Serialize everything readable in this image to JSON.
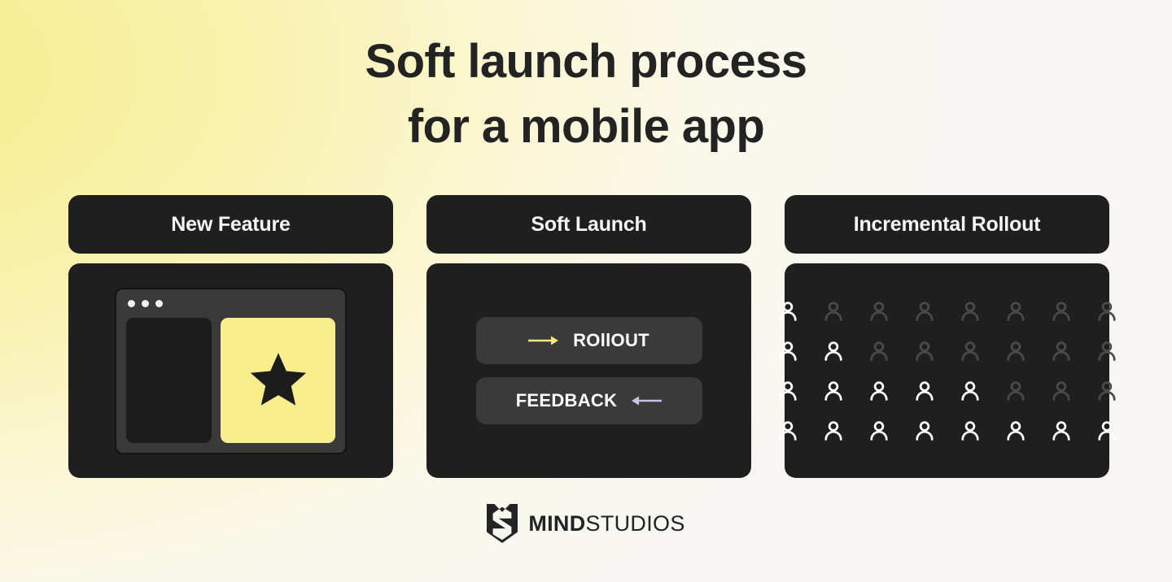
{
  "theme": {
    "background_base": "#F7F6F2",
    "glow_yellow": "#F6EC8C",
    "card_dark": "#1F1F1F",
    "chip_grey": "#3A3A3A",
    "accent_yellow": "#F9EE8E",
    "accent_lavender": "#C6C3E6",
    "text_light": "#F5F5F3",
    "text_dark": "#232323",
    "person_on": "#FFFFFF",
    "person_off": "#4A4A4A"
  },
  "title": {
    "line1": "Soft launch process",
    "line2": "for a mobile app"
  },
  "columns": [
    {
      "header": "New Feature",
      "kind": "app-window",
      "window": {
        "dots": 3,
        "left_pane": "empty-placeholder-pane",
        "right_pane": "featured-star-pane",
        "star_icon": "star-icon"
      }
    },
    {
      "header": "Soft Launch",
      "kind": "chips",
      "chips": [
        {
          "label": "ROllOUT",
          "icon": "arrow-right-icon",
          "icon_position": "before",
          "icon_color": "#EFE87F"
        },
        {
          "label": "FEEDBACK",
          "icon": "arrow-left-icon",
          "icon_position": "after",
          "icon_color": "#C6C3E6"
        }
      ]
    },
    {
      "header": "Incremental Rollout",
      "kind": "people-grid",
      "people_grid": {
        "columns": 8,
        "rows": 4,
        "active_per_row": [
          1,
          2,
          5,
          8
        ],
        "icon": "person-icon"
      }
    }
  ],
  "footer": {
    "logo_mark": "mind-studios-shield-icon",
    "word_bold": "MIND",
    "word_regular": "STUDIOS"
  }
}
